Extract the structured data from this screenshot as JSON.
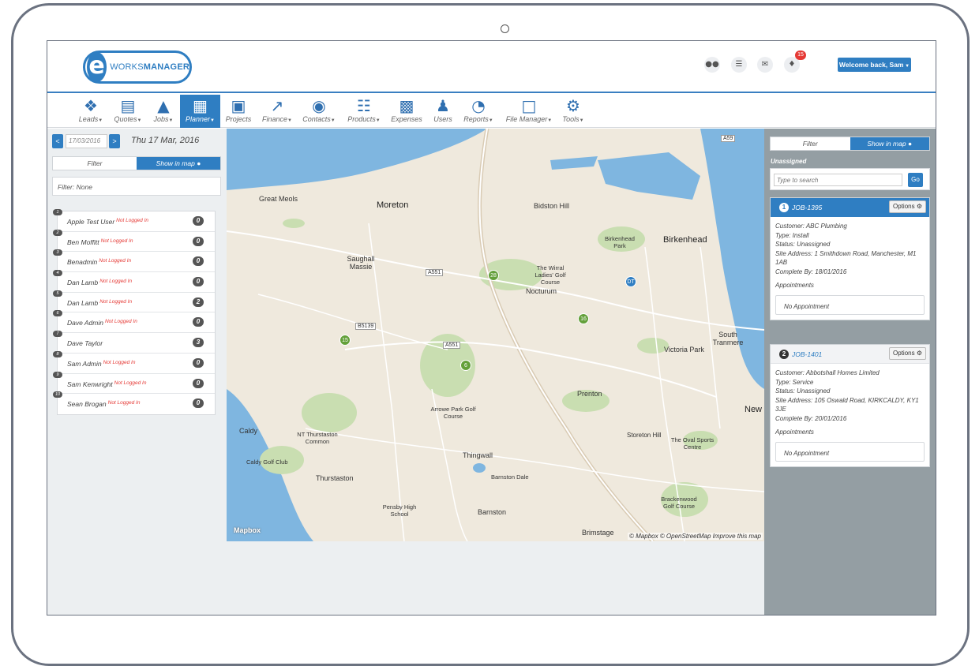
{
  "header": {
    "logo_letter": "e",
    "logo_works": "WORKS",
    "logo_manager": "MANAGER",
    "notification_count": "15",
    "welcome": "Welcome back, Sam",
    "icons": [
      "users-icon",
      "list-icon",
      "mail-icon",
      "bell-icon"
    ]
  },
  "nav": {
    "items": [
      {
        "label": "Leads",
        "icon": "pin-icon",
        "dropdown": true
      },
      {
        "label": "Quotes",
        "icon": "document-icon",
        "dropdown": true
      },
      {
        "label": "Jobs",
        "icon": "road-icon",
        "dropdown": true
      },
      {
        "label": "Planner",
        "icon": "calendar-icon",
        "dropdown": true,
        "active": true
      },
      {
        "label": "Projects",
        "icon": "briefcase-icon",
        "dropdown": false
      },
      {
        "label": "Finance",
        "icon": "chart-icon",
        "dropdown": true
      },
      {
        "label": "Contacts",
        "icon": "chat-icon",
        "dropdown": true
      },
      {
        "label": "Products",
        "icon": "cart-icon",
        "dropdown": true
      },
      {
        "label": "Expenses",
        "icon": "calculator-icon",
        "dropdown": false
      },
      {
        "label": "Users",
        "icon": "users-icon",
        "dropdown": false
      },
      {
        "label": "Reports",
        "icon": "pie-icon",
        "dropdown": true
      },
      {
        "label": "File Manager",
        "icon": "pdf-icon",
        "dropdown": true
      },
      {
        "label": "Tools",
        "icon": "cogs-icon",
        "dropdown": true
      }
    ]
  },
  "planner": {
    "prev": "<",
    "next": ">",
    "date_value": "17/03/2016",
    "date_label": "Thu 17 Mar, 2016",
    "toggle_filter": "Filter",
    "toggle_map": "Show in map",
    "filter_text": "Filter: None",
    "users": [
      {
        "num": "1",
        "name": "Apple Test User",
        "status": "Not Logged In",
        "count": "0"
      },
      {
        "num": "2",
        "name": "Ben Moffitt",
        "status": "Not Logged In",
        "count": "0"
      },
      {
        "num": "3",
        "name": "Benadmin",
        "status": "Not Logged In",
        "count": "0"
      },
      {
        "num": "4",
        "name": "Dan Lamb",
        "status": "Not Logged In",
        "count": "0"
      },
      {
        "num": "5",
        "name": "Dan Lamb",
        "status": "Not Logged In",
        "count": "2"
      },
      {
        "num": "6",
        "name": "Dave Admin",
        "status": "Not Logged In",
        "count": "0"
      },
      {
        "num": "7",
        "name": "Dave Taylor",
        "status": "",
        "count": "3"
      },
      {
        "num": "8",
        "name": "Sam Admin",
        "status": "Not Logged In",
        "count": "0"
      },
      {
        "num": "9",
        "name": "Sam Kenwright",
        "status": "Not Logged In",
        "count": "0"
      },
      {
        "num": "10",
        "name": "Sean Brogan",
        "status": "Not Logged In",
        "count": "0"
      }
    ]
  },
  "map": {
    "places": [
      "Moreton",
      "Bidston Hill",
      "Birkenhead",
      "Great Meols",
      "Saughall Massie",
      "Nocturum",
      "The Wirral Ladies' Golf Course",
      "Birkenhead Park",
      "Victoria Park",
      "South Tranmere",
      "Prenton",
      "Arrowe Park Golf Course",
      "Caldy",
      "NT Thurstaston Common",
      "Caldy Golf Club",
      "Thurstaston",
      "Thingwall",
      "Barnston Dale",
      "Storeton Hill",
      "The Oval Sports Centre",
      "Brackenwood Golf Course",
      "Pensby High School",
      "Barnston",
      "Brimstage",
      "New"
    ],
    "roads": [
      "A551",
      "B5139",
      "A59",
      "A551"
    ],
    "clusters": [
      {
        "label": "28",
        "color": "green"
      },
      {
        "label": "DT",
        "color": "blue"
      },
      {
        "label": "16",
        "color": "green"
      },
      {
        "label": "15",
        "color": "green"
      },
      {
        "label": "6",
        "color": "green"
      }
    ],
    "brand": "Mapbox",
    "attribution": "© Mapbox © OpenStreetMap Improve this map"
  },
  "sidebar": {
    "toggle_filter": "Filter",
    "toggle_map": "Show in map",
    "unassigned_label": "Unassigned",
    "search_placeholder": "Type to search",
    "go": "Go",
    "jobs": [
      {
        "num": "1",
        "id": "JOB-1395",
        "options": "Options",
        "customer": "Customer: ABC Plumbing",
        "type": "Type: Install",
        "status": "Status: Unassigned",
        "address": "Site Address: 1 Smithdown Road, Manchester, M1 1AB",
        "complete_by": "Complete By: 18/01/2016",
        "appointments_label": "Appointments",
        "appointment": "No Appointment"
      },
      {
        "num": "2",
        "id": "JOB-1401",
        "options": "Options",
        "customer": "Customer: Abbotshall Homes Limited",
        "type": "Type: Service",
        "status": "Status: Unassigned",
        "address": "Site Address: 105 Oswald Road, KIRKCALDY, KY1 3JE",
        "complete_by": "Complete By: 20/01/2016",
        "appointments_label": "Appointments",
        "appointment": "No Appointment"
      }
    ]
  },
  "colors": {
    "accent": "#2f7ec2",
    "sidebar_bg": "#949ea3",
    "status_red": "#e53935",
    "cluster_green": "#63a03a"
  }
}
